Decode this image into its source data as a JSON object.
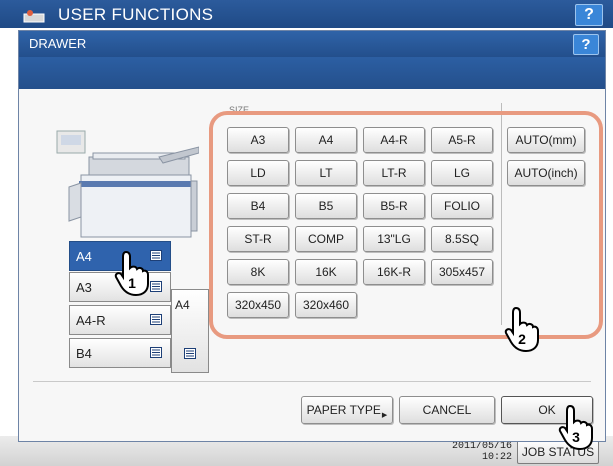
{
  "screen": {
    "title": "USER FUNCTIONS",
    "help_label": "?",
    "clock_date": "2011/05/16",
    "clock_time": "10:22",
    "job_status_label": "JOB STATUS"
  },
  "dialog": {
    "title": "DRAWER",
    "help_label": "?",
    "size_label": "SIZE",
    "size_buttons": [
      [
        "A3",
        "A4",
        "A4-R",
        "A5-R"
      ],
      [
        "LD",
        "LT",
        "LT-R",
        "LG"
      ],
      [
        "B4",
        "B5",
        "B5-R",
        "FOLIO"
      ],
      [
        "ST-R",
        "COMP",
        "13\"LG",
        "8.5SQ"
      ],
      [
        "8K",
        "16K",
        "16K-R",
        "305x457"
      ],
      [
        "320x450",
        "320x460"
      ]
    ],
    "auto_buttons": [
      "AUTO(mm)",
      "AUTO(inch)"
    ],
    "drawers": [
      {
        "label": "A4",
        "selected": true
      },
      {
        "label": "A3",
        "selected": false
      },
      {
        "label": "A4-R",
        "selected": false
      },
      {
        "label": "B4",
        "selected": false
      }
    ],
    "bypass_label": "A4",
    "footer": {
      "paper_type_label": "PAPER TYPE",
      "cancel_label": "CANCEL",
      "ok_label": "OK"
    },
    "callouts": [
      "1",
      "2",
      "3"
    ]
  },
  "colors": {
    "title_bar": "#234f8c",
    "selected_drawer": "#2f63ad",
    "highlight_frame": "#e89a80"
  }
}
